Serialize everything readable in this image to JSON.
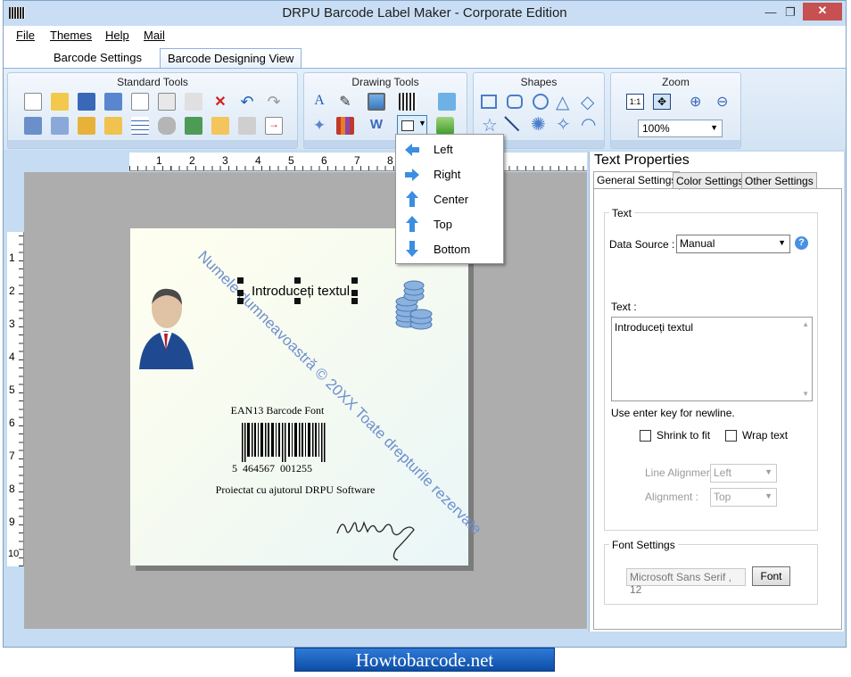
{
  "window": {
    "title": "DRPU Barcode Label Maker - Corporate Edition",
    "min": "—",
    "max": "❐",
    "close": "✕"
  },
  "menu": [
    "File",
    "Themes",
    "Help",
    "Mail"
  ],
  "ribbon_tabs": [
    "Barcode Settings",
    "Barcode Designing View"
  ],
  "groups": {
    "standard": "Standard Tools",
    "drawing": "Drawing Tools",
    "shapes": "Shapes",
    "zoom": "Zoom"
  },
  "zoom": {
    "label_11": "1:1",
    "value": "100%"
  },
  "ruler_top": [
    "1",
    "2",
    "3",
    "4",
    "5",
    "6",
    "7",
    "8"
  ],
  "ruler_left": [
    "1",
    "2",
    "3",
    "4",
    "5",
    "6",
    "7",
    "8",
    "9",
    "10"
  ],
  "align_menu": {
    "items": [
      "Left",
      "Right",
      "Center",
      "Top",
      "Bottom"
    ]
  },
  "label": {
    "selected_text": "Introduceți textul",
    "watermark": "Numele dumneavoastră © 20XX Toate drepturile rezervate",
    "barcode_font": "EAN13 Barcode Font",
    "barcode_number": "5  464567  001255",
    "footer": "Proiectat cu ajutorul DRPU Software"
  },
  "panel": {
    "title": "Text Properties",
    "tabs": [
      "General Settings",
      "Color Settings",
      "Other Settings"
    ],
    "text_group": "Text",
    "data_source_label": "Data Source :",
    "data_source_value": "Manual",
    "help": "?",
    "text_label": "Text :",
    "text_value": "Introduceți textul",
    "hint": "Use enter key for newline.",
    "shrink": "Shrink to fit",
    "wrap": "Wrap text",
    "line_alignment_label": "Line Alignment :",
    "line_alignment_value": "Left",
    "alignment_label": "Alignment :",
    "alignment_value": "Top",
    "font_group": "Font Settings",
    "font_value": "Microsoft Sans Serif , 12",
    "font_button": "Font"
  },
  "watermark_site": "Howtobarcode.net"
}
